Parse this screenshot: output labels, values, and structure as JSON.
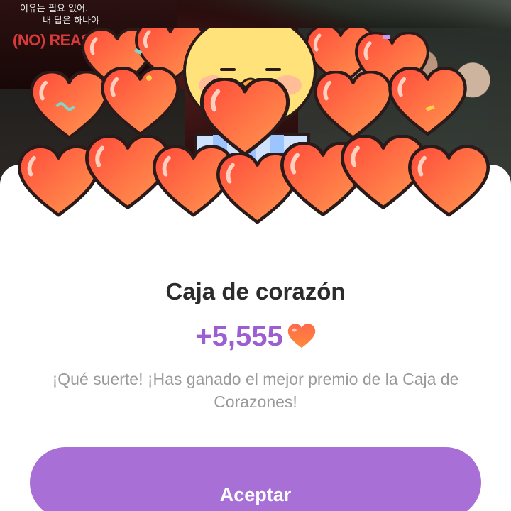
{
  "background": {
    "korean_line1": "이유는 필요 없어.",
    "korean_line2": "내 답은 하나야",
    "poster_title": "(NO) REASON"
  },
  "dialog": {
    "title": "Caja de corazón",
    "amount": "+5,555",
    "amount_icon": "heart-icon",
    "message": "¡Qué suerte! ¡Has ganado el mejor premio de la Caja de Corazones!",
    "accept_label": "Aceptar"
  },
  "colors": {
    "accent": "#a86fd6",
    "amount_text": "#9b5fd1",
    "heart": "#ff5a3c",
    "chick": "#ffe27a",
    "title_text": "#2c2c2c",
    "message_text": "#9a9a9a"
  }
}
